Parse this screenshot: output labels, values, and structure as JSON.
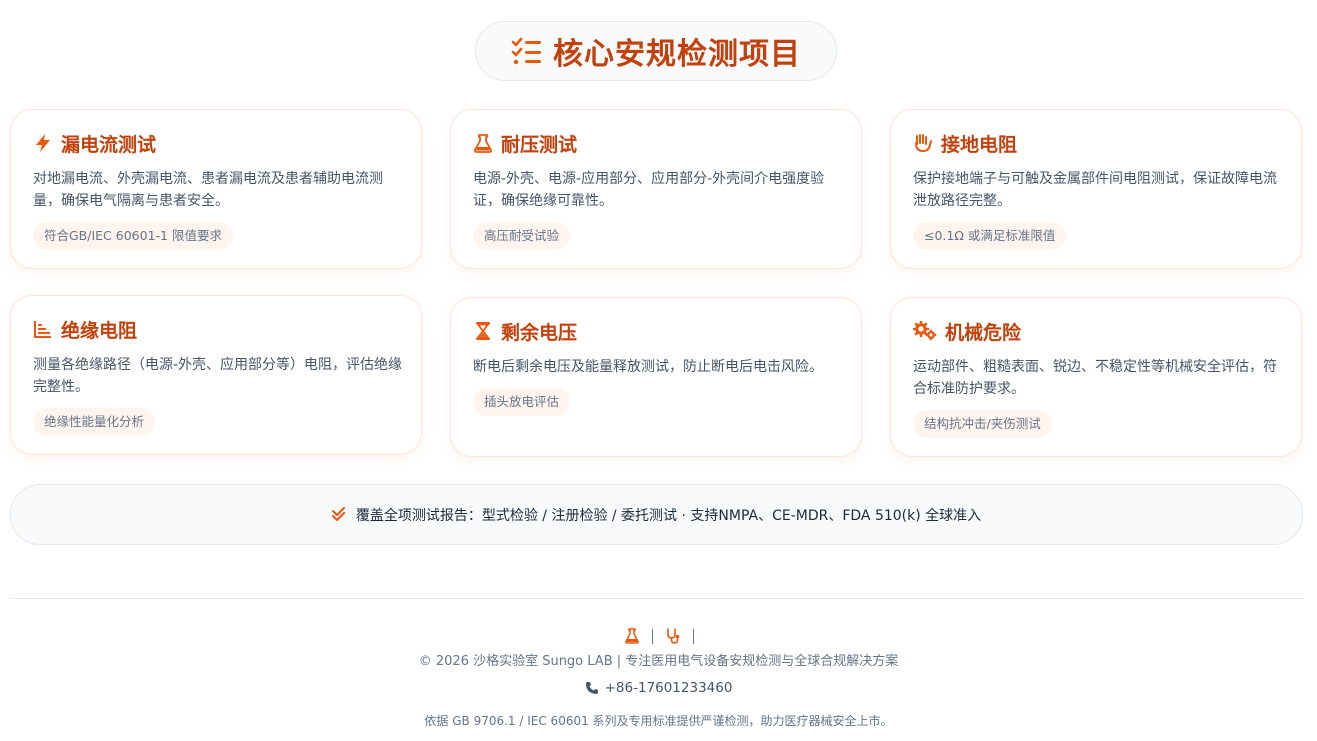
{
  "header": {
    "icon": "checklist-icon",
    "title": "核心安规检测项目"
  },
  "cards": [
    {
      "icon": "bolt-icon",
      "title": "漏电流测试",
      "desc": "对地漏电流、外壳漏电流、患者漏电流及患者辅助电流测量，确保电气隔离与患者安全。",
      "tag": "符合GB/IEC 60601-1 限值要求"
    },
    {
      "icon": "flask-icon",
      "title": "耐压测试",
      "desc": "电源-外壳、电源-应用部分、应用部分-外壳间介电强度验证，确保绝缘可靠性。",
      "tag": "高压耐受试验"
    },
    {
      "icon": "hand-icon",
      "title": "接地电阻",
      "desc": "保护接地端子与可触及金属部件间电阻测试，保证故障电流泄放路径完整。",
      "tag": "≤0.1Ω 或满足标准限值"
    },
    {
      "icon": "bar-chart-icon",
      "title": "绝缘电阻",
      "desc": "测量各绝缘路径（电源-外壳、应用部分等）电阻，评估绝缘完整性。",
      "tag": "绝缘性能量化分析"
    },
    {
      "icon": "hourglass-icon",
      "title": "剩余电压",
      "desc": "断电后剩余电压及能量释放测试，防止断电后电击风险。",
      "tag": "插头放电评估"
    },
    {
      "icon": "gears-icon",
      "title": "机械危险",
      "desc": "运动部件、粗糙表面、锐边、不稳定性等机械安全评估，符合标准防护要求。",
      "tag": "结构抗冲击/夹伤测试"
    }
  ],
  "summary": {
    "icon": "double-check-icon",
    "text": "覆盖全项测试报告：型式检验 / 注册检验 / 委托测试 · 支持NMPA、CE-MDR、FDA 510(k) 全球准入"
  },
  "footer": {
    "icons": [
      "flask-icon",
      "stethoscope-icon"
    ],
    "copyright": "© 2026 沙格实验室 Sungo LAB | 专注医用电气设备安规检测与全球合规解决方案",
    "phone_icon": "phone-icon",
    "phone": "+86-17601233460",
    "note": "依据 GB 9706.1 / IEC 60601 系列及专用标准提供严谨检测，助力医疗器械安全上市。"
  },
  "colors": {
    "accent": "#c2410c",
    "icon": "#ea580c",
    "card_border": "#fde2d6",
    "tag_bg": "#fff5ee",
    "pill_bg": "#f8fafc"
  }
}
